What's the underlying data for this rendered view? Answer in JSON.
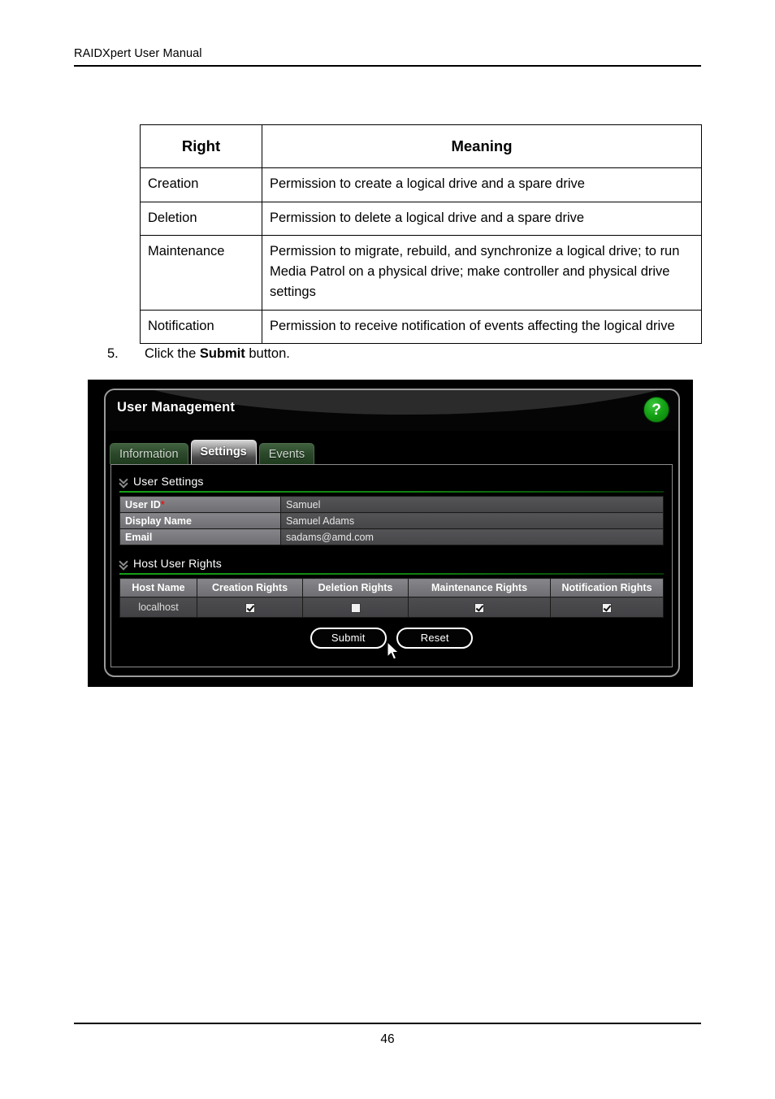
{
  "document": {
    "header_title": "RAIDXpert User Manual",
    "page_number": "46"
  },
  "rights_table": {
    "columns": [
      "Right",
      "Meaning"
    ],
    "rows": [
      {
        "right": "Creation",
        "meaning": "Permission to create a logical drive and a spare drive"
      },
      {
        "right": "Deletion",
        "meaning": "Permission to delete a logical drive and a spare drive"
      },
      {
        "right": "Maintenance",
        "meaning": "Permission to migrate, rebuild, and synchronize a logical drive; to run Media Patrol on a physical drive; make controller and physical drive settings"
      },
      {
        "right": "Notification",
        "meaning": "Permission to receive notification of events affecting the logical drive"
      }
    ]
  },
  "step": {
    "number": "5.",
    "text_before": "Click the ",
    "bold_word": "Submit",
    "text_after": " button."
  },
  "app": {
    "title": "User Management",
    "help_label": "?",
    "tabs": [
      {
        "label": "Information",
        "active": false
      },
      {
        "label": "Settings",
        "active": true
      },
      {
        "label": "Events",
        "active": false
      }
    ],
    "user_settings": {
      "section_title": "User Settings",
      "fields": [
        {
          "label": "User ID",
          "required_mark": "*",
          "value": "Samuel"
        },
        {
          "label": "Display Name",
          "required_mark": "",
          "value": "Samuel Adams"
        },
        {
          "label": "Email",
          "required_mark": "",
          "value": "sadams@amd.com"
        }
      ]
    },
    "host_user_rights": {
      "section_title": "Host User Rights",
      "columns": [
        "Host Name",
        "Creation Rights",
        "Deletion Rights",
        "Maintenance Rights",
        "Notification Rights"
      ],
      "rows": [
        {
          "host_name": "localhost",
          "creation": true,
          "deletion": false,
          "maintenance": true,
          "notification": true
        }
      ]
    },
    "buttons": {
      "submit_label": "Submit",
      "reset_label": "Reset"
    },
    "colors": {
      "accent_green": "#15a315",
      "tab_green": "#2d4a2c",
      "required_red": "#e01b1b",
      "panel_border": "#9a9a9a"
    }
  }
}
